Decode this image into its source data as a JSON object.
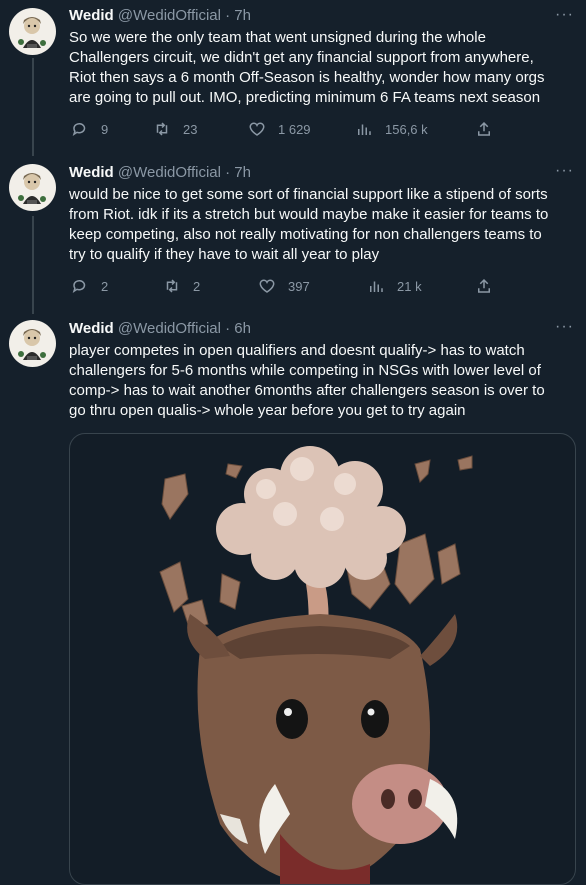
{
  "tweets": [
    {
      "name": "Wedid",
      "handle": "@WedidOfficial",
      "dot": "·",
      "time": "7h",
      "lines": [
        "So we were the only team that went unsigned during the whole",
        "Challengers circuit, we didn't get any financial support from anywhere,",
        "Riot then says a 6 month Off-Season is healthy, wonder how many orgs",
        "are going to pull out. IMO, predicting minimum 6 FA teams next season"
      ],
      "replies": "9",
      "retweets": "23",
      "likes": "1 629",
      "views": "156,6 k"
    },
    {
      "name": "Wedid",
      "handle": "@WedidOfficial",
      "dot": "·",
      "time": "7h",
      "lines": [
        "would be nice to get some sort of financial support like a stipend of sorts",
        "from Riot. idk if its a stretch but would maybe make it easier for teams to",
        "keep competing, also not really motivating for non challengers teams to",
        "try to qualify if they have to wait all year to play"
      ],
      "replies": "2",
      "retweets": "2",
      "likes": "397",
      "views": "21 k"
    },
    {
      "name": "Wedid",
      "handle": "@WedidOfficial",
      "dot": "·",
      "time": "6h",
      "lines": [
        "player competes in open qualifiers and doesnt qualify-> has to watch",
        "challengers for 5-6 months while competing in NSGs with lower level of",
        "comp-> has to wait another 6months after challengers season is over to",
        "go thru open qualis-> whole year before you get to try again"
      ]
    }
  ],
  "more_icon": "···",
  "media": {
    "description_icon": "exploding-head-boar-memoji"
  },
  "colors": {
    "background": "#15202b",
    "text": "#f7f9f9",
    "muted": "#8b98a5",
    "border": "#38444d"
  }
}
